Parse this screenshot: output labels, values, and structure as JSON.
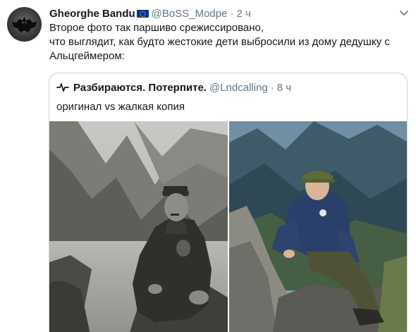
{
  "tweet": {
    "author": {
      "display_name": "Gheorghe Bandu",
      "handle": "@BoSS_Modpe",
      "badge_icon": "eu-flag-icon"
    },
    "separator": "·",
    "time": "2 ч",
    "text_lines": [
      "Второе фото так паршиво срежиссировано,",
      "что выглядит, как будто жестокие дети выбросили из дому дедушку с",
      "Альцгеймером:"
    ],
    "menu_icon": "chevron-down-icon"
  },
  "quoted_tweet": {
    "author": {
      "display_name": "Разбираются. Потерпите.",
      "handle": "@Lndcalling",
      "avatar_icon": "pulse-icon"
    },
    "separator": "·",
    "time": "8 ч",
    "text": "оригинал vs жалкая копия",
    "photos": [
      "left-photo",
      "right-photo"
    ]
  },
  "colors": {
    "text": "#14171a",
    "muted": "#657786",
    "border": "#ccd6dd",
    "eu_blue": "#003399",
    "eu_gold": "#ffcc00"
  }
}
